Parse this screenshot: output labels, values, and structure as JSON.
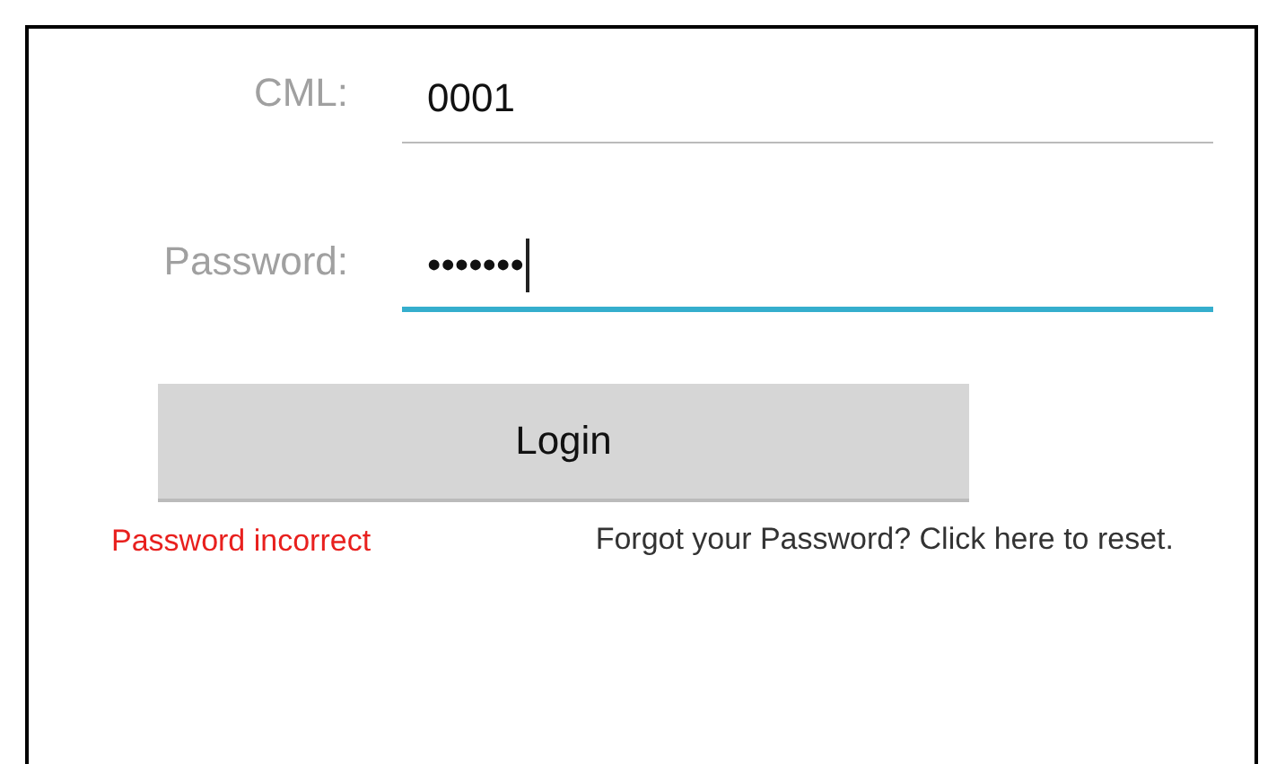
{
  "fields": [
    {
      "label": "CML:",
      "value": "0001",
      "focused": false
    },
    {
      "label": "Password:",
      "value": "•••••••",
      "focused": true
    }
  ],
  "button": {
    "label": "Login"
  },
  "error": "Password incorrect",
  "forgot_link": "Forgot your Password? Click here to reset."
}
